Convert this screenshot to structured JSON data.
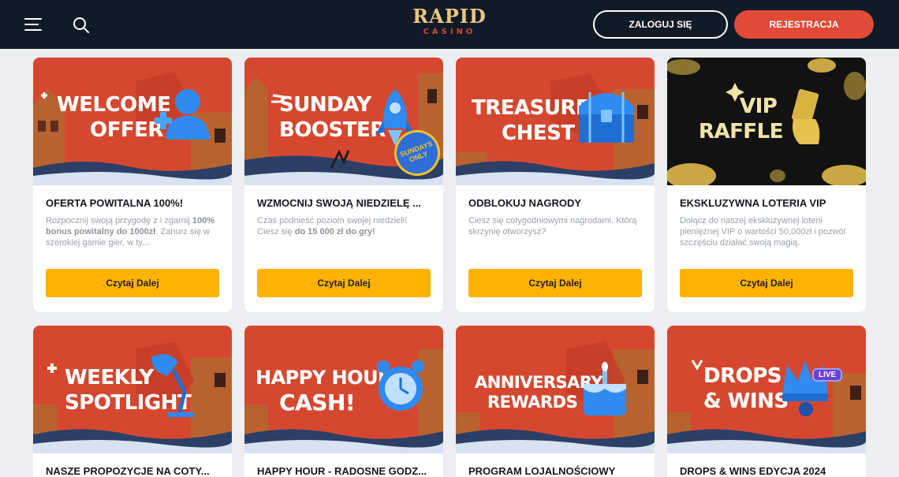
{
  "header": {
    "logo_main": "RAPID",
    "logo_sub": "CASINO",
    "login_label": "ZALOGUJ SIĘ",
    "register_label": "REJESTRACJA"
  },
  "colors": {
    "header_bg": "#111a27",
    "accent": "#e04a37",
    "cta": "#ffb200",
    "banner_red": "#d6472f"
  },
  "cards": [
    {
      "banner_line1": "WELCOME",
      "banner_line2": "OFFER",
      "title": "OFERTA POWITALNA 100%!",
      "desc_pre": "Rozpocznij swoją przygodę z i zgarnij ",
      "desc_bold": "100% bonus powitalny do 1000zł",
      "desc_post": ". Zanurz się w szerokiej gamie gier, w ty...",
      "cta": "Czytaj Dalej"
    },
    {
      "banner_line1": "SUNDAY",
      "banner_line2": "BOOSTER",
      "badge": "SUNDAYS ONLY",
      "title": "WZMOCNIJ SWOJĄ NIEDZIELĘ ...",
      "desc_pre": "Czas podnieść poziom swojej niedzieli! Ciesz się ",
      "desc_bold": "do 15 000 zł do gry!",
      "desc_post": "",
      "cta": "Czytaj Dalej"
    },
    {
      "banner_line1": "TREASURE",
      "banner_line2": "CHEST",
      "title": "ODBLOKUJ NAGRODY",
      "desc_pre": "Ciesz się cotygodniowymi nagrodami. Którą skrzynię otworzysz?",
      "desc_bold": "",
      "desc_post": "",
      "cta": "Czytaj Dalej"
    },
    {
      "banner_line1": "VIP",
      "banner_line2": "RAFFLE",
      "title": "EKSKLUZYWNA LOTERIA VIP",
      "desc_pre": "Dołącz do naszej ekskluzywnej loterii pieniężnej VIP o wartości 50,000zł i pozwól szczęściu działać swoją magią.",
      "desc_bold": "",
      "desc_post": "",
      "cta": "Czytaj Dalej"
    },
    {
      "banner_line1": "WEEKLY",
      "banner_line2": "SPOTLIGHT",
      "title": "NASZE PROPOZYCJE NA COTY..."
    },
    {
      "banner_line1": "HAPPY HOUR",
      "banner_line2": "CASH!",
      "title": "HAPPY HOUR - RADOSNE GODZ..."
    },
    {
      "banner_line1": "ANNIVERSARY",
      "banner_line2": "REWARDS",
      "title": "PROGRAM LOJALNOŚCIOWY"
    },
    {
      "banner_line1": "DROPS",
      "banner_line2": "& WINS",
      "badge": "LIVE",
      "title": "DROPS & WINS EDYCJA 2024"
    }
  ]
}
